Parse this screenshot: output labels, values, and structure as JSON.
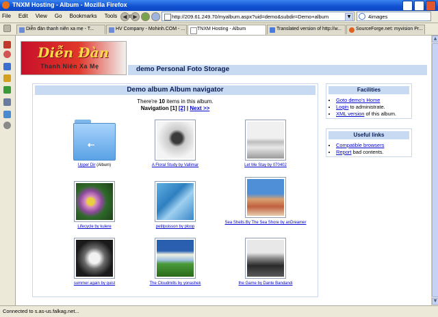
{
  "window": {
    "title": "TNXM Hosting - Album - Mozilla Firefox"
  },
  "menu": [
    "File",
    "Edit",
    "View",
    "Go",
    "Bookmarks",
    "Tools",
    "Help"
  ],
  "address": {
    "url": "http://209.61.249.70/myalbum.aspx?uid=demo&subdir=Demo+album"
  },
  "search": {
    "value": "4images"
  },
  "tabs": [
    {
      "label": "Diễn đàn thanh niên xa mẹ - T..."
    },
    {
      "label": "HV Company - Mohinh.COM - ..."
    },
    {
      "label": "TNXM Hosting - Album"
    },
    {
      "label": "Translated version of http://w..."
    },
    {
      "label": "SourceForge.net: myvision Pr..."
    }
  ],
  "site": {
    "logo_line1": "Diễn Đàn",
    "logo_line2": "Thanh Niên Xa Mẹ",
    "header": "demo Personal Foto Storage"
  },
  "album": {
    "navigator_title": "Demo album Album navigator",
    "count_prefix": "There're",
    "count": "10",
    "count_suffix": "items in this album.",
    "nav_label": "Navigation",
    "page_current": "[1]",
    "page_other": "[2]",
    "separator": "|",
    "next_label": "Next >>",
    "items": [
      {
        "caption": "Upper Dir",
        "suffix": "(Album)",
        "type": "folder"
      },
      {
        "caption": "A Floral Study by Vallimar",
        "type": "photo"
      },
      {
        "caption": "Let Me Stay by 070402",
        "type": "photo"
      },
      {
        "caption": "Lifecycle by kulere",
        "type": "photo"
      },
      {
        "caption": "petitpoisson by ploop",
        "type": "photo"
      },
      {
        "caption": "Sea Shells By The Sea Shore by anDreamer",
        "type": "photo"
      },
      {
        "caption": "summer again by quist",
        "type": "photo"
      },
      {
        "caption": "The Cloudmills by yonashek",
        "type": "photo"
      },
      {
        "caption": "the Game by Dante Bandandi",
        "type": "photo"
      }
    ]
  },
  "facilities": {
    "title": "Facilities",
    "items": [
      {
        "link": "Goto demo's Home",
        "rest": ""
      },
      {
        "link": "Login",
        "rest": "to administrate."
      },
      {
        "link": "XML version",
        "rest": "of this album."
      }
    ]
  },
  "useful_links": {
    "title": "Useful links",
    "items": [
      {
        "link": "Compatible browsers",
        "rest": ""
      },
      {
        "link": "Report",
        "rest": "bad contents."
      }
    ]
  },
  "status": {
    "text": "Connected to s.as-us.falkag.net..."
  }
}
